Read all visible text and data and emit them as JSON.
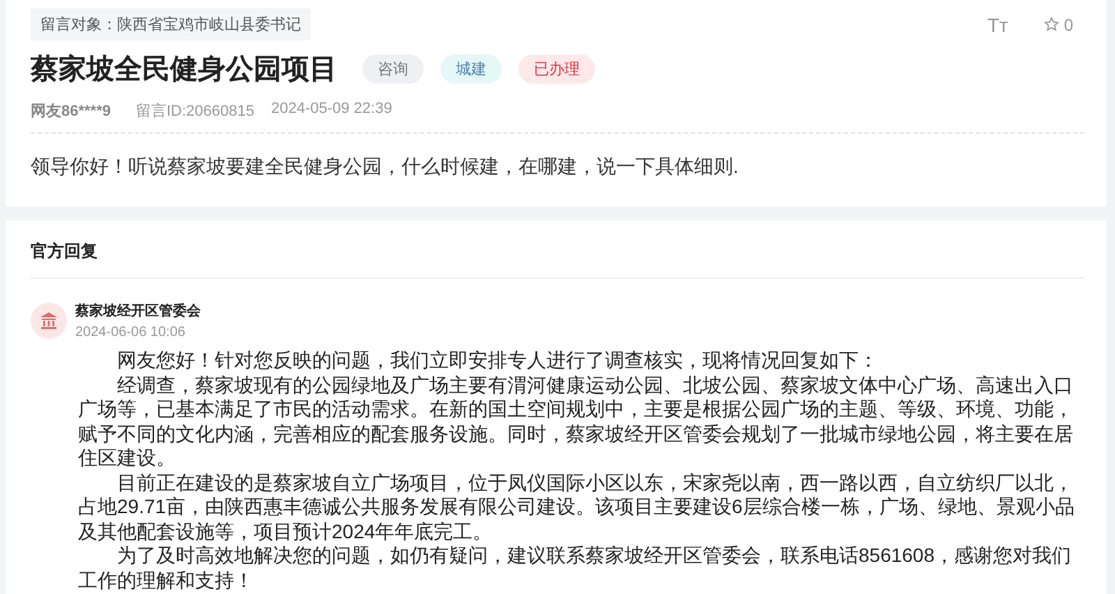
{
  "message": {
    "target": "留言对象：陕西省宝鸡市岐山县委书记",
    "title": "蔡家坡全民健身公园项目",
    "tags": [
      {
        "label": "咨询",
        "kind": "type"
      },
      {
        "label": "城建",
        "kind": "field"
      },
      {
        "label": "已办理",
        "kind": "status"
      }
    ],
    "author": "网友86****9",
    "message_id": "留言ID:20660815",
    "time": "2024-05-09 22:39",
    "font_size_button": "Tт",
    "likes": "0",
    "content": "领导你好！听说蔡家坡要建全民健身公园，什么时候建，在哪建，说一下具体细则."
  },
  "reply": {
    "heading": "官方回复",
    "department": "蔡家坡经开区管委会",
    "time": "2024-06-06 10:06",
    "paragraphs": [
      "网友您好！针对您反映的问题，我们立即安排专人进行了调查核实，现将情况回复如下：",
      "经调查，蔡家坡现有的公园绿地及广场主要有渭河健康运动公园、北坡公园、蔡家坡文体中心广场、高速出入口广场等，已基本满足了市民的活动需求。在新的国土空间规划中，主要是根据公园广场的主题、等级、环境、功能，赋予不同的文化内涵，完善相应的配套服务设施。同时，蔡家坡经开区管委会规划了一批城市绿地公园，将主要在居住区建设。",
      "目前正在建设的是蔡家坡自立广场项目，位于凤仪国际小区以东，宋家尧以南，西一路以西，自立纺织厂以北，占地29.71亩，由陕西惠丰德诚公共服务发展有限公司建设。该项目主要建设6层综合楼一栋，广场、绿地、景观小品及其他配套设施等，项目预计2024年年底完工。",
      "为了及时高效地解决您的问题，如仍有疑问，建议联系蔡家坡经开区管委会，联系电话8561608，感谢您对我们工作的理解和支持！"
    ]
  }
}
